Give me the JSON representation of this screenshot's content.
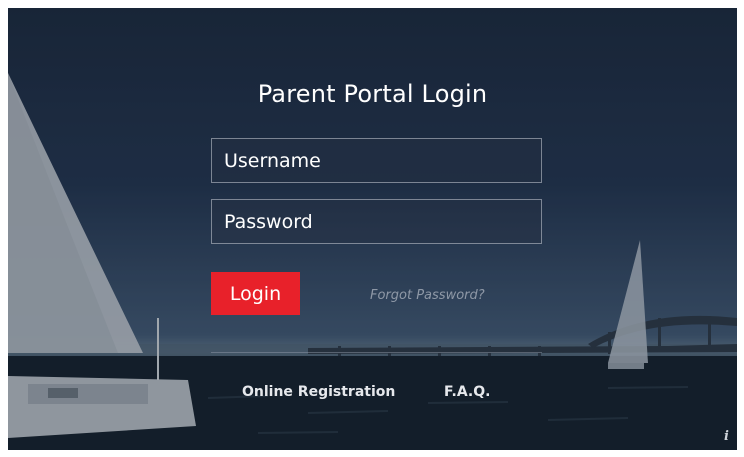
{
  "login": {
    "title": "Parent Portal Login",
    "username_placeholder": "Username",
    "password_placeholder": "Password",
    "login_label": "Login",
    "forgot_label": "Forgot Password?"
  },
  "footer": {
    "registration_label": "Online Registration",
    "faq_label": "F.A.Q.",
    "info_label": "i"
  },
  "colors": {
    "accent": "#e8212a",
    "overlay": "#1c2a3f"
  }
}
